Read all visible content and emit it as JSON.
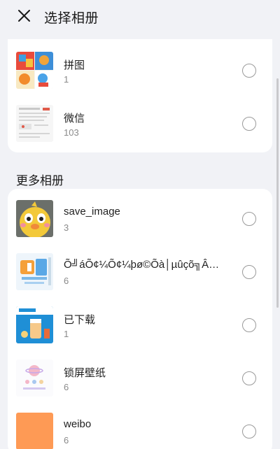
{
  "header": {
    "close_icon": "close-icon",
    "title": "选择相册"
  },
  "top_albums": [
    {
      "name": "拼图",
      "count": "1",
      "thumb": "puzzle-collage-thumb"
    },
    {
      "name": "微信",
      "count": "103",
      "thumb": "wechat-screenshot-thumb"
    }
  ],
  "more_section": {
    "label": "更多相册"
  },
  "more_albums": [
    {
      "name": "save_image",
      "count": "3",
      "thumb": "yellow-chick-thumb"
    },
    {
      "name": "Õ╝áÕ¢¼Õ¢¼þø©Õà│µûçõ╗Â╝╡…",
      "count": "6",
      "thumb": "blue-poster-thumb"
    },
    {
      "name": "已下载",
      "count": "1",
      "thumb": "drink-ad-thumb"
    },
    {
      "name": "锁屏壁纸",
      "count": "6",
      "thumb": "pink-wallpaper-thumb"
    },
    {
      "name": "weibo",
      "count": "6",
      "thumb": "orange-block-thumb"
    }
  ],
  "colors": {
    "background": "#f1f2f6",
    "card": "#ffffff",
    "orange_thumb": "#fe9a55"
  }
}
